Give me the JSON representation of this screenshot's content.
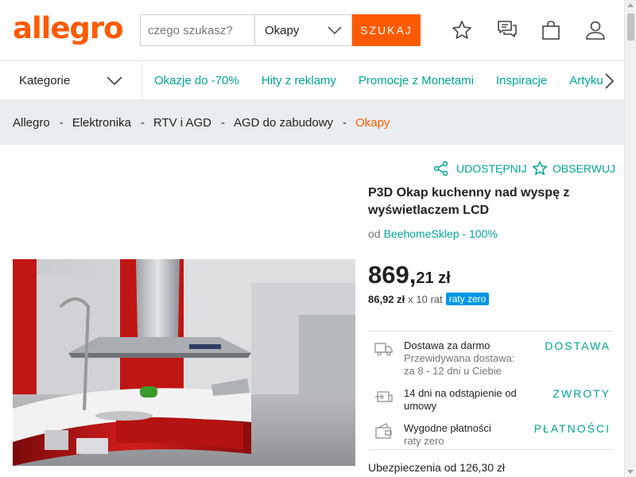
{
  "header": {
    "logo": "allegro",
    "search_placeholder": "czego szukasz?",
    "category_select": "Okapy",
    "search_button": "SZUKAJ",
    "icons": [
      "star-icon",
      "chat-icon",
      "bag-icon",
      "user-icon"
    ]
  },
  "nav": {
    "categories_label": "Kategorie",
    "links": [
      "Okazje do -70%",
      "Hity z reklamy",
      "Promocje z Monetami",
      "Inspiracje",
      "Artykuły"
    ]
  },
  "breadcrumb": {
    "items": [
      "Allegro",
      "Elektronika",
      "RTV i AGD",
      "AGD do zabudowy"
    ],
    "separator": "-",
    "current": "Okapy"
  },
  "product": {
    "share_label": "UDOSTĘPNIJ",
    "watch_label": "OBSERWUJ",
    "title": "P3D Okap kuchenny nad wyspę z wyświetlaczem LCD",
    "seller_prefix": "od",
    "seller": "BeehomeSklep - 100%",
    "price_int": "869,",
    "price_dec": "21 zł",
    "installment_amount": "86,92 zł",
    "installment_count": "x 10 rat",
    "installment_badge": "raty zero",
    "delivery": {
      "title": "Dostawa za darmo",
      "line2": "Przewidywana dostawa:",
      "line3": "za 8 - 12 dni u Ciebie",
      "action": "DOSTAWA"
    },
    "returns": {
      "title": "14 dni na odstąpienie od umowy",
      "action": "ZWROTY"
    },
    "payments": {
      "title": "Wygodne płatności",
      "line2": "raty zero",
      "action": "PŁATNOŚCI"
    },
    "insurance": "Ubezpieczenia od 126,30 zł"
  },
  "colors": {
    "brand": "#ff5a00",
    "link": "#00a790",
    "badge": "#0098e6"
  }
}
